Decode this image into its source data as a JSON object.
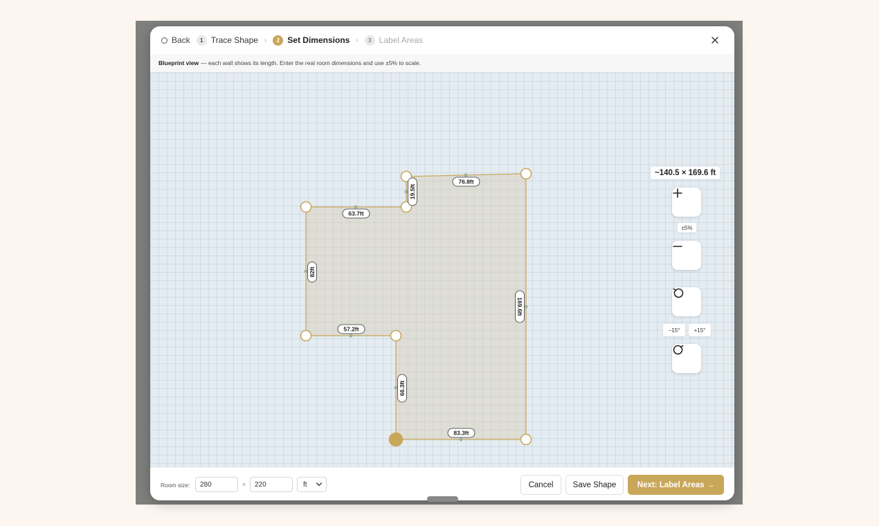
{
  "header": {
    "back_label": "Back",
    "steps": [
      {
        "num": "1",
        "label": "Trace Shape",
        "state": "done"
      },
      {
        "num": "2",
        "label": "Set Dimensions",
        "state": "active"
      },
      {
        "num": "3",
        "label": "Label Areas",
        "state": "upcoming"
      }
    ],
    "close_icon": "close-icon"
  },
  "info": {
    "bold": "Blueprint view",
    "text": "— each wall shows its length. Enter the real room dimensions and use ±5% to scale."
  },
  "canvas": {
    "dimensions_badge": "~140.5 × 169.6 ft",
    "walls": [
      {
        "label": "76.8ft"
      },
      {
        "label": "19.5ft"
      },
      {
        "label": "63.7ft"
      },
      {
        "label": "82ft"
      },
      {
        "label": "57.2ft"
      },
      {
        "label": "66.3ft"
      },
      {
        "label": "83.3ft"
      },
      {
        "label": "169.6ft"
      }
    ],
    "shape_color": "#c9a75a",
    "zoom_in_icon": "plus-icon",
    "zoom_out_icon": "minus-icon",
    "scale_label": "±5%",
    "rotate_left_icon": "rotate-ccw-icon",
    "rotate_right_icon": "rotate-cw-icon",
    "rotate_minus_label": "−15°",
    "rotate_plus_label": "+15°"
  },
  "footer": {
    "room_size_label": "Room size:",
    "width_value": "280",
    "times": "×",
    "height_value": "220",
    "unit": "ft",
    "cancel_label": "Cancel",
    "save_label": "Save Shape",
    "next_label": "Next: Label Areas →",
    "accent": "#c9a75a"
  }
}
